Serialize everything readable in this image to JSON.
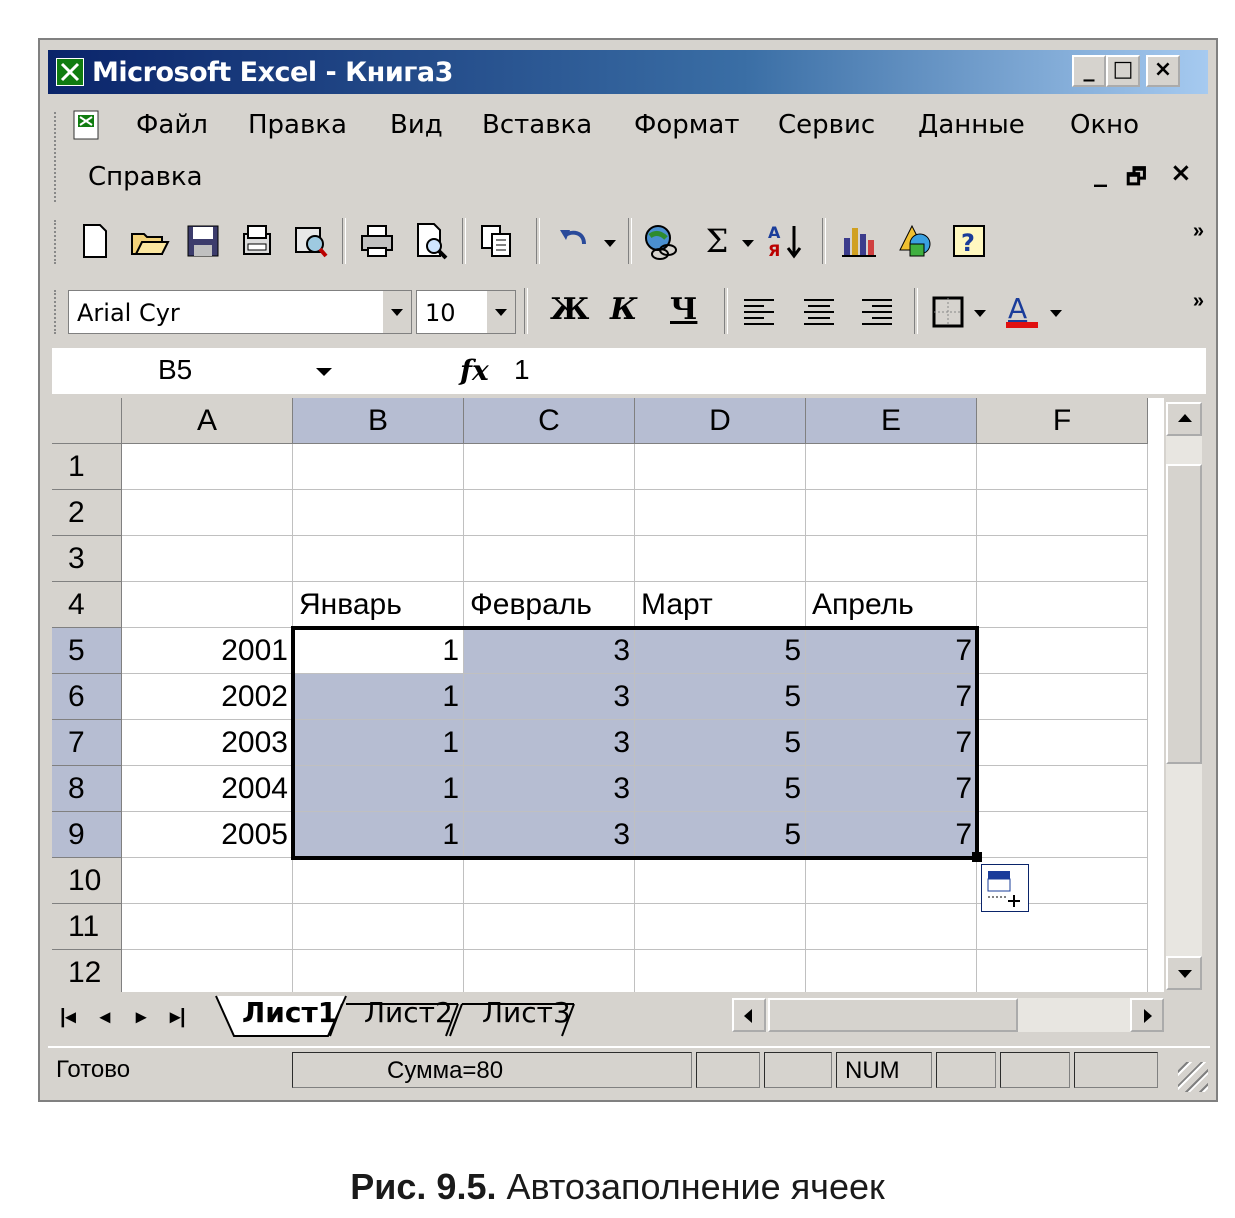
{
  "window": {
    "title": "Microsoft Excel - Книга3",
    "min": "_",
    "max": "□",
    "close": "×"
  },
  "menu": {
    "items": [
      "Файл",
      "Правка",
      "Вид",
      "Вставка",
      "Формат",
      "Сервис",
      "Данные",
      "Окно",
      "Справка"
    ],
    "doc_minimize": "_",
    "doc_restore": "🗗",
    "doc_close": "×"
  },
  "format_toolbar": {
    "font": "Arial Cyr",
    "size": "10",
    "bold": "Ж",
    "italic": "К",
    "underline": "Ч"
  },
  "standard_toolbar": {
    "icons": [
      "new-icon",
      "open-icon",
      "save-icon",
      "permission-icon",
      "research-icon",
      "print-icon",
      "print-preview-icon",
      "copy-icon",
      "undo-icon",
      "hyperlink-icon",
      "autosum-icon",
      "sort-ascending-icon",
      "chart-wizard-icon",
      "drawing-icon",
      "help-icon"
    ],
    "sigma": "Σ",
    "more": "»"
  },
  "formula_bar": {
    "name_box": "B5",
    "fx": "fx",
    "value": "1"
  },
  "sheet": {
    "columns": [
      "A",
      "B",
      "C",
      "D",
      "E",
      "F"
    ],
    "rows": [
      "1",
      "2",
      "3",
      "4",
      "5",
      "6",
      "7",
      "8",
      "9",
      "10",
      "11",
      "12"
    ],
    "headers": [
      "Январь",
      "Февраль",
      "Март",
      "Апрель"
    ],
    "years": [
      "2001",
      "2002",
      "2003",
      "2004",
      "2005"
    ],
    "values": [
      [
        "1",
        "3",
        "5",
        "7"
      ],
      [
        "1",
        "3",
        "5",
        "7"
      ],
      [
        "1",
        "3",
        "5",
        "7"
      ],
      [
        "1",
        "3",
        "5",
        "7"
      ],
      [
        "1",
        "3",
        "5",
        "7"
      ]
    ]
  },
  "tabs": [
    "Лист1",
    "Лист2",
    "Лист3"
  ],
  "status": {
    "ready": "Готово",
    "sum": "Сумма=80",
    "num": "NUM"
  },
  "caption": {
    "bold": "Рис. 9.5.",
    "text": " Автозаполнение ячеек"
  },
  "colors": {
    "selection": "#b6bdd2",
    "titlebar_start": "#0a246a",
    "face": "#d6d3ce"
  }
}
